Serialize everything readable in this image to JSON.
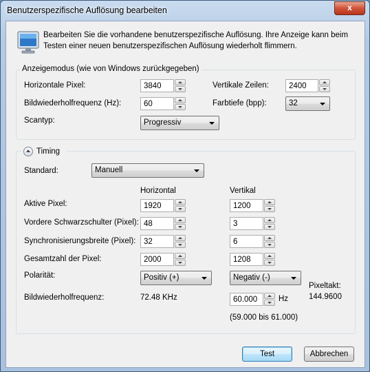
{
  "title": "Benutzerspezifische Auflösung bearbeiten",
  "close_glyph": "x",
  "info_text_1": "Bearbeiten Sie die vorhandene benutzerspezifische Auflösung. Ihre Anzeige kann beim",
  "info_text_2": "Testen einer neuen benutzerspezifischen Auflösung wiederholt flimmern.",
  "display_mode": {
    "group_title": "Anzeigemodus (wie von Windows zurückgegeben)",
    "horizontal_pixels_label": "Horizontale Pixel:",
    "horizontal_pixels": "3840",
    "vertical_lines_label": "Vertikale Zeilen:",
    "vertical_lines": "2400",
    "refresh_label": "Bildwiederholfrequenz (Hz):",
    "refresh": "60",
    "color_depth_label": "Farbtiefe (bpp):",
    "color_depth": "32",
    "scan_type_label": "Scantyp:",
    "scan_type": "Progressiv"
  },
  "timing": {
    "group_title": "Timing",
    "standard_label": "Standard:",
    "standard": "Manuell",
    "col_horizontal": "Horizontal",
    "col_vertical": "Vertikal",
    "rows": [
      {
        "label": "Aktive Pixel:",
        "h": "1920",
        "v": "1200"
      },
      {
        "label": "Vordere Schwarzschulter (Pixel):",
        "h": "48",
        "v": "3"
      },
      {
        "label": "Synchronisierungsbreite (Pixel):",
        "h": "32",
        "v": "6"
      },
      {
        "label": "Gesamtzahl der Pixel:",
        "h": "2000",
        "v": "1208"
      }
    ],
    "polarity_label": "Polarität:",
    "polarity_h": "Positiv (+)",
    "polarity_v": "Negativ (-)",
    "refresh_label": "Bildwiederholfrequenz:",
    "refresh_h": "72.48 KHz",
    "refresh_v": "60.000",
    "refresh_unit": "Hz",
    "refresh_range": "(59.000 bis 61.000)",
    "pixel_clock_label": "Pixeltakt:",
    "pixel_clock": "144.9600"
  },
  "buttons": {
    "test": "Test",
    "cancel": "Abbrechen"
  }
}
